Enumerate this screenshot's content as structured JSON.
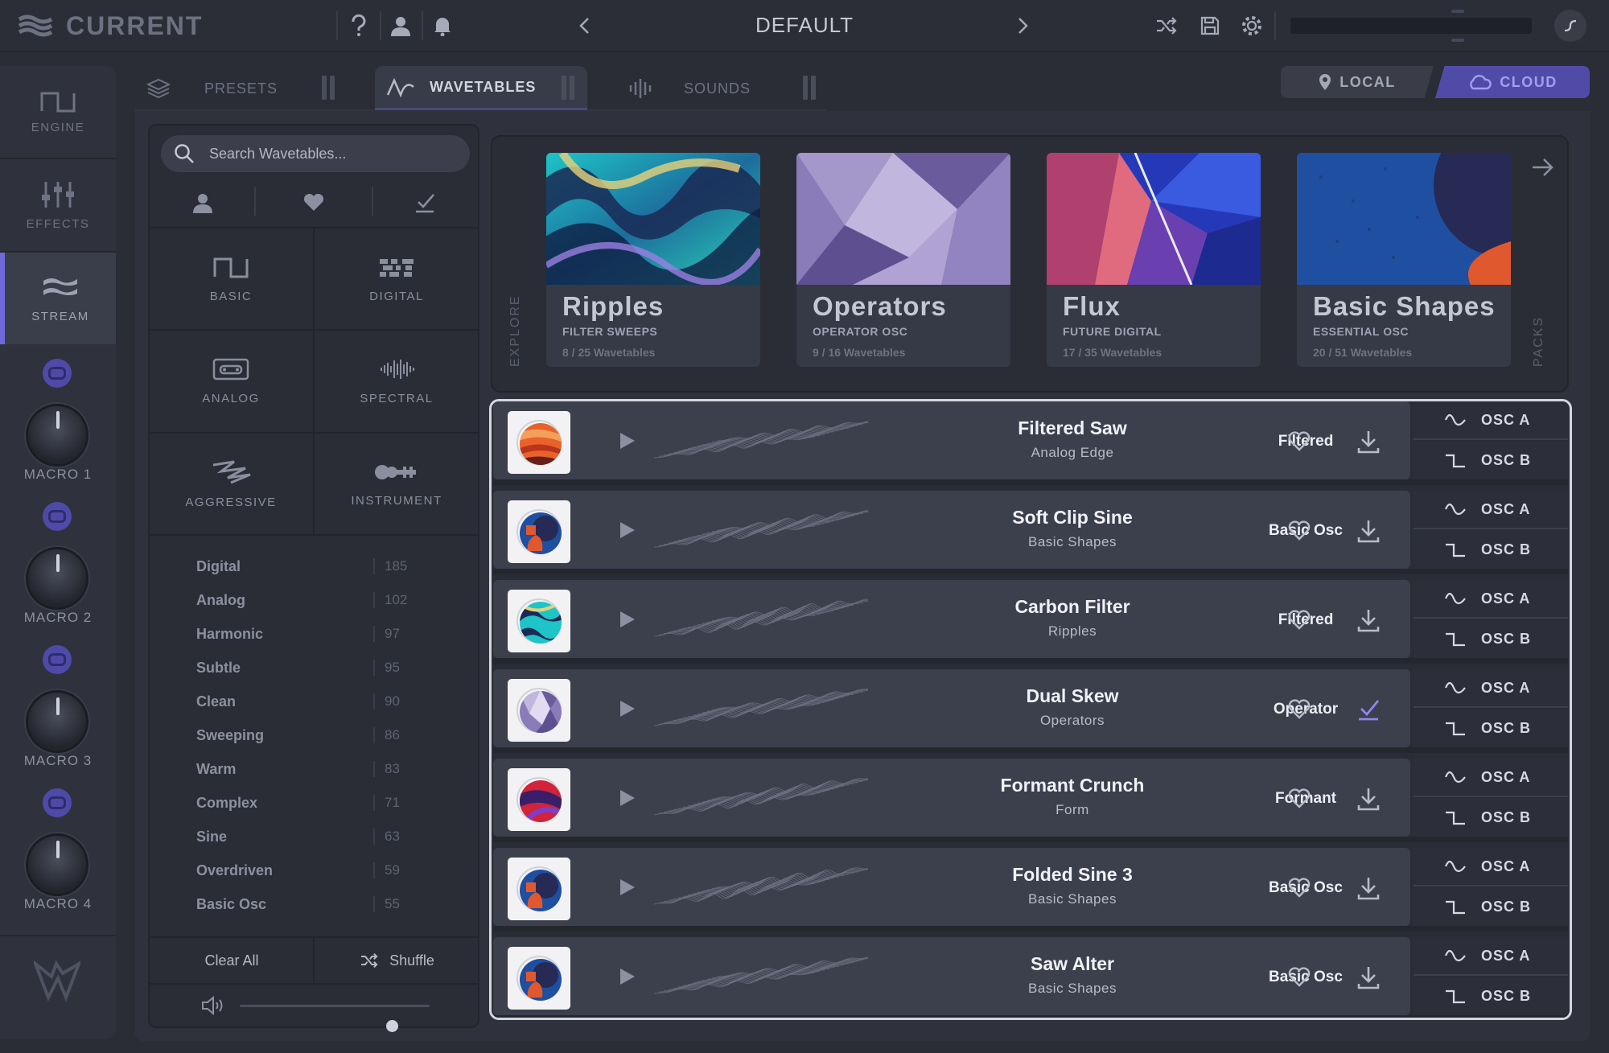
{
  "app": {
    "title": "CURRENT",
    "preset_name": "DEFAULT"
  },
  "topbar": {
    "icons": [
      "help-icon",
      "user-icon",
      "bell-icon",
      "chevron-left-icon",
      "chevron-right-icon",
      "shuffle-icon",
      "save-icon",
      "gear-icon",
      "power-icon"
    ]
  },
  "leftnav": {
    "items": [
      {
        "label": "ENGINE",
        "icon": "engine-icon",
        "active": false
      },
      {
        "label": "EFFECTS",
        "icon": "sliders-icon",
        "active": false
      },
      {
        "label": "STREAM",
        "icon": "stream-icon",
        "active": true
      }
    ],
    "macros": [
      "MACRO 1",
      "MACRO 2",
      "MACRO 3",
      "MACRO 4"
    ]
  },
  "tabs": [
    {
      "label": "PRESETS",
      "active": false
    },
    {
      "label": "WAVETABLES",
      "active": true
    },
    {
      "label": "SOUNDS",
      "active": false
    }
  ],
  "source": {
    "local": "LOCAL",
    "cloud": "CLOUD",
    "selected": "CLOUD"
  },
  "filters": {
    "search_placeholder": "Search Wavetables...",
    "search_value": "",
    "categories": [
      {
        "label": "BASIC",
        "icon": "square-wave-icon"
      },
      {
        "label": "DIGITAL",
        "icon": "digital-icon"
      },
      {
        "label": "ANALOG",
        "icon": "cassette-icon"
      },
      {
        "label": "SPECTRAL",
        "icon": "spectral-icon"
      },
      {
        "label": "AGGRESSIVE",
        "icon": "aggressive-icon"
      },
      {
        "label": "INSTRUMENT",
        "icon": "instrument-icon"
      }
    ],
    "tags": [
      {
        "name": "Digital",
        "count": "185"
      },
      {
        "name": "Analog",
        "count": "102"
      },
      {
        "name": "Harmonic",
        "count": "97"
      },
      {
        "name": "Subtle",
        "count": "95"
      },
      {
        "name": "Clean",
        "count": "90"
      },
      {
        "name": "Sweeping",
        "count": "86"
      },
      {
        "name": "Warm",
        "count": "83"
      },
      {
        "name": "Complex",
        "count": "71"
      },
      {
        "name": "Sine",
        "count": "63"
      },
      {
        "name": "Overdriven",
        "count": "59"
      },
      {
        "name": "Basic Osc",
        "count": "55"
      }
    ],
    "clear_all": "Clear All",
    "shuffle": "Shuffle",
    "volume": 0.8
  },
  "packs": {
    "explore_label": "EXPLORE",
    "packs_label": "PACKS",
    "items": [
      {
        "name": "Ripples",
        "subtitle": "FILTER SWEEPS",
        "count": "8 / 25 Wavetables"
      },
      {
        "name": "Operators",
        "subtitle": "OPERATOR OSC",
        "count": "9 / 16 Wavetables"
      },
      {
        "name": "Flux",
        "subtitle": "FUTURE DIGITAL",
        "count": "17 / 35 Wavetables"
      },
      {
        "name": "Basic Shapes",
        "subtitle": "ESSENTIAL OSC",
        "count": "20 / 51 Wavetables"
      }
    ]
  },
  "wavetables": [
    {
      "name": "Filtered Saw",
      "pack": "Analog Edge",
      "tag": "Filtered",
      "downloaded": false,
      "thumb": "orange"
    },
    {
      "name": "Soft Clip Sine",
      "pack": "Basic Shapes",
      "tag": "Basic Osc",
      "downloaded": false,
      "thumb": "blue"
    },
    {
      "name": "Carbon Filter",
      "pack": "Ripples",
      "tag": "Filtered",
      "downloaded": false,
      "thumb": "teal"
    },
    {
      "name": "Dual Skew",
      "pack": "Operators",
      "tag": "Operator",
      "downloaded": true,
      "thumb": "lilac"
    },
    {
      "name": "Formant Crunch",
      "pack": "Form",
      "tag": "Formant",
      "downloaded": false,
      "thumb": "red"
    },
    {
      "name": "Folded Sine 3",
      "pack": "Basic Shapes",
      "tag": "Basic Osc",
      "downloaded": false,
      "thumb": "blue"
    },
    {
      "name": "Saw Alter",
      "pack": "Basic Shapes",
      "tag": "Basic Osc",
      "downloaded": false,
      "thumb": "blue"
    }
  ],
  "osc_labels": {
    "a": "OSC A",
    "b": "OSC B"
  },
  "colors": {
    "accent": "#6f69d9",
    "cloud_bg": "#514ba8",
    "download_done": "#8d86f0"
  }
}
